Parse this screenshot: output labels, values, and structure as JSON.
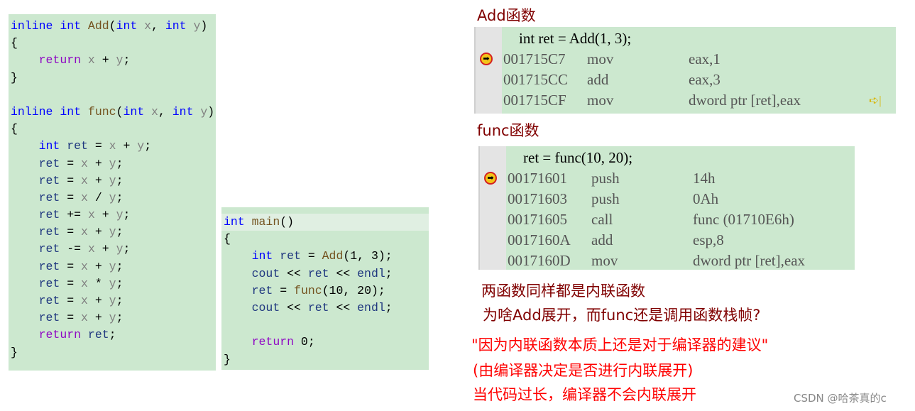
{
  "left_code": [
    [
      [
        "inline ",
        "kw"
      ],
      [
        "int ",
        "kw"
      ],
      [
        "Add",
        "fn"
      ],
      [
        "(",
        "tx"
      ],
      [
        "int ",
        "kw"
      ],
      [
        "x",
        "pm"
      ],
      [
        ", ",
        "tx"
      ],
      [
        "int ",
        "kw"
      ],
      [
        "y",
        "pm"
      ],
      [
        ")",
        "tx"
      ]
    ],
    [
      [
        "{",
        "tx"
      ]
    ],
    [
      [
        "    ",
        "tx"
      ],
      [
        "return ",
        "rt"
      ],
      [
        "x",
        "pm"
      ],
      [
        " + ",
        "tx"
      ],
      [
        "y",
        "pm"
      ],
      [
        ";",
        "tx"
      ]
    ],
    [
      [
        "}",
        "tx"
      ]
    ],
    [
      [
        "",
        "tx"
      ]
    ],
    [
      [
        "inline ",
        "kw"
      ],
      [
        "int ",
        "kw"
      ],
      [
        "func",
        "fn"
      ],
      [
        "(",
        "tx"
      ],
      [
        "int ",
        "kw"
      ],
      [
        "x",
        "pm"
      ],
      [
        ", ",
        "tx"
      ],
      [
        "int ",
        "kw"
      ],
      [
        "y",
        "pm"
      ],
      [
        ")",
        "tx"
      ]
    ],
    [
      [
        "{",
        "tx"
      ]
    ],
    [
      [
        "    ",
        "tx"
      ],
      [
        "int ",
        "kw"
      ],
      [
        "ret",
        "lv"
      ],
      [
        " = ",
        "tx"
      ],
      [
        "x",
        "pm"
      ],
      [
        " + ",
        "tx"
      ],
      [
        "y",
        "pm"
      ],
      [
        ";",
        "tx"
      ]
    ],
    [
      [
        "    ",
        "tx"
      ],
      [
        "ret",
        "lv"
      ],
      [
        " = ",
        "tx"
      ],
      [
        "x",
        "pm"
      ],
      [
        " + ",
        "tx"
      ],
      [
        "y",
        "pm"
      ],
      [
        ";",
        "tx"
      ]
    ],
    [
      [
        "    ",
        "tx"
      ],
      [
        "ret",
        "lv"
      ],
      [
        " = ",
        "tx"
      ],
      [
        "x",
        "pm"
      ],
      [
        " + ",
        "tx"
      ],
      [
        "y",
        "pm"
      ],
      [
        ";",
        "tx"
      ]
    ],
    [
      [
        "    ",
        "tx"
      ],
      [
        "ret",
        "lv"
      ],
      [
        " = ",
        "tx"
      ],
      [
        "x",
        "pm"
      ],
      [
        " / ",
        "tx"
      ],
      [
        "y",
        "pm"
      ],
      [
        ";",
        "tx"
      ]
    ],
    [
      [
        "    ",
        "tx"
      ],
      [
        "ret",
        "lv"
      ],
      [
        " += ",
        "tx"
      ],
      [
        "x",
        "pm"
      ],
      [
        " + ",
        "tx"
      ],
      [
        "y",
        "pm"
      ],
      [
        ";",
        "tx"
      ]
    ],
    [
      [
        "    ",
        "tx"
      ],
      [
        "ret",
        "lv"
      ],
      [
        " = ",
        "tx"
      ],
      [
        "x",
        "pm"
      ],
      [
        " + ",
        "tx"
      ],
      [
        "y",
        "pm"
      ],
      [
        ";",
        "tx"
      ]
    ],
    [
      [
        "    ",
        "tx"
      ],
      [
        "ret",
        "lv"
      ],
      [
        " -= ",
        "tx"
      ],
      [
        "x",
        "pm"
      ],
      [
        " + ",
        "tx"
      ],
      [
        "y",
        "pm"
      ],
      [
        ";",
        "tx"
      ]
    ],
    [
      [
        "    ",
        "tx"
      ],
      [
        "ret",
        "lv"
      ],
      [
        " = ",
        "tx"
      ],
      [
        "x",
        "pm"
      ],
      [
        " + ",
        "tx"
      ],
      [
        "y",
        "pm"
      ],
      [
        ";",
        "tx"
      ]
    ],
    [
      [
        "    ",
        "tx"
      ],
      [
        "ret",
        "lv"
      ],
      [
        " = ",
        "tx"
      ],
      [
        "x",
        "pm"
      ],
      [
        " * ",
        "tx"
      ],
      [
        "y",
        "pm"
      ],
      [
        ";",
        "tx"
      ]
    ],
    [
      [
        "    ",
        "tx"
      ],
      [
        "ret",
        "lv"
      ],
      [
        " = ",
        "tx"
      ],
      [
        "x",
        "pm"
      ],
      [
        " + ",
        "tx"
      ],
      [
        "y",
        "pm"
      ],
      [
        ";",
        "tx"
      ]
    ],
    [
      [
        "    ",
        "tx"
      ],
      [
        "ret",
        "lv"
      ],
      [
        " = ",
        "tx"
      ],
      [
        "x",
        "pm"
      ],
      [
        " + ",
        "tx"
      ],
      [
        "y",
        "pm"
      ],
      [
        ";",
        "tx"
      ]
    ],
    [
      [
        "    ",
        "tx"
      ],
      [
        "return ",
        "rt"
      ],
      [
        "ret",
        "lv"
      ],
      [
        ";",
        "tx"
      ]
    ],
    [
      [
        "}",
        "tx"
      ]
    ]
  ],
  "main_code": [
    [
      [
        "int ",
        "kw"
      ],
      [
        "main",
        "fn"
      ],
      [
        "()",
        "tx"
      ]
    ],
    [
      [
        "{",
        "tx"
      ]
    ],
    [
      [
        "    ",
        "tx"
      ],
      [
        "int ",
        "kw"
      ],
      [
        "ret",
        "lv"
      ],
      [
        " = ",
        "tx"
      ],
      [
        "Add",
        "fn"
      ],
      [
        "(1, 3);",
        "tx"
      ]
    ],
    [
      [
        "    ",
        "tx"
      ],
      [
        "cout",
        "lv"
      ],
      [
        " << ",
        "tx"
      ],
      [
        "ret",
        "lv"
      ],
      [
        " << ",
        "tx"
      ],
      [
        "endl",
        "lv"
      ],
      [
        ";",
        "tx"
      ]
    ],
    [
      [
        "    ",
        "tx"
      ],
      [
        "ret",
        "lv"
      ],
      [
        " = ",
        "tx"
      ],
      [
        "func",
        "fn"
      ],
      [
        "(10, 20);",
        "tx"
      ]
    ],
    [
      [
        "    ",
        "tx"
      ],
      [
        "cout",
        "lv"
      ],
      [
        " << ",
        "tx"
      ],
      [
        "ret",
        "lv"
      ],
      [
        " << ",
        "tx"
      ],
      [
        "endl",
        "lv"
      ],
      [
        ";",
        "tx"
      ]
    ],
    [
      [
        "",
        "tx"
      ]
    ],
    [
      [
        "    ",
        "tx"
      ],
      [
        "return ",
        "rt"
      ],
      [
        "0;",
        "tx"
      ]
    ],
    [
      [
        "}",
        "tx"
      ]
    ]
  ],
  "add_section": {
    "title": "Add函数",
    "source": "    int ret = Add(1, 3);",
    "rows": [
      {
        "addr": "001715C7",
        "op": "mov",
        "args": "eax,1",
        "current": true
      },
      {
        "addr": "001715CC",
        "op": "add",
        "args": "eax,3"
      },
      {
        "addr": "001715CF",
        "op": "mov",
        "args": "dword ptr [ret],eax",
        "step_icon": true
      }
    ]
  },
  "func_section": {
    "title": "func函数",
    "source": "    ret = func(10, 20);",
    "rows": [
      {
        "addr": "00171601",
        "op": "push",
        "args": "14h",
        "current": true
      },
      {
        "addr": "00171603",
        "op": "push",
        "args": "0Ah"
      },
      {
        "addr": "00171605",
        "op": "call",
        "args": "func (01710E6h)"
      },
      {
        "addr": "0017160A",
        "op": "add",
        "args": "esp,8"
      },
      {
        "addr": "0017160D",
        "op": "mov",
        "args": "dword ptr [ret],eax"
      }
    ]
  },
  "notes": {
    "q1": "两函数同样都是内联函数",
    "q2": "为啥Add展开，而func还是调用函数栈帧?",
    "a1": "\"因为内联函数本质上还是对于编译器的建议\"",
    "a2": "(由编译器决定是否进行内联展开)",
    "a3": "当代码过长，编译器不会内联展开"
  },
  "colors": {
    "code_bg": "#cce8cf",
    "keyword": "#0000ff",
    "question": "#800000",
    "answer": "#ff0000"
  },
  "watermark": "CSDN @哈茶真的c"
}
